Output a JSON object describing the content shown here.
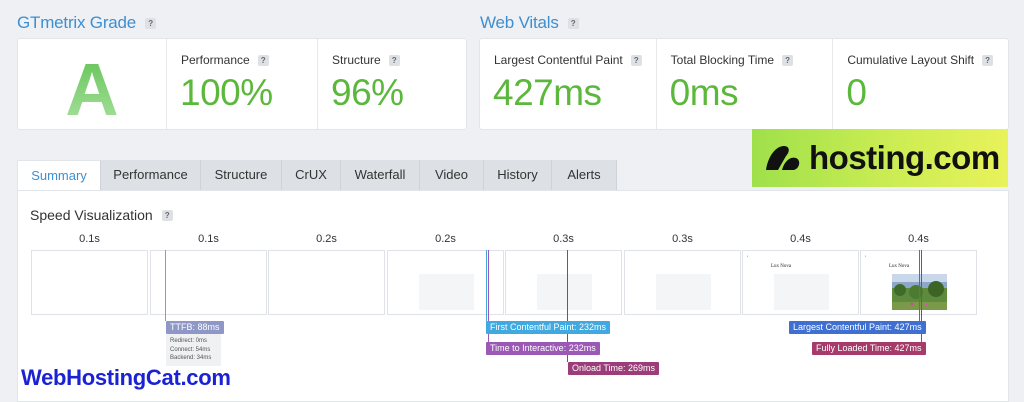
{
  "gtmetrix": {
    "title": "GTmetrix Grade",
    "grade": "A",
    "performance_label": "Performance",
    "performance_value": "100%",
    "structure_label": "Structure",
    "structure_value": "96%"
  },
  "web_vitals": {
    "title": "Web Vitals",
    "lcp_label": "Largest Contentful Paint",
    "lcp_value": "427ms",
    "tbt_label": "Total Blocking Time",
    "tbt_value": "0ms",
    "cls_label": "Cumulative Layout Shift",
    "cls_value": "0"
  },
  "help_icon": "?",
  "ad": {
    "text": "hosting.com",
    "accent": "#b8e84a"
  },
  "tabs": [
    {
      "label": "Summary"
    },
    {
      "label": "Performance"
    },
    {
      "label": "Structure"
    },
    {
      "label": "CrUX"
    },
    {
      "label": "Waterfall"
    },
    {
      "label": "Video"
    },
    {
      "label": "History"
    },
    {
      "label": "Alerts"
    }
  ],
  "speed": {
    "title": "Speed Visualization",
    "timestamps": [
      "0.1s",
      "0.1s",
      "0.2s",
      "0.2s",
      "0.3s",
      "0.3s",
      "0.4s",
      "0.4s"
    ],
    "frame_heading": "Lux Nova",
    "markers": {
      "ttfb": "TTFB: 88ms",
      "redirect": "Redirect: 0ms",
      "connect": "Connect: 54ms",
      "backend": "Backend: 34ms",
      "fcp": "First Contentful Paint: 232ms",
      "tti": "Time to Interactive: 232ms",
      "onload": "Onload Time: 269ms",
      "lcp": "Largest Contentful Paint: 427ms",
      "fully_loaded": "Fully Loaded Time: 427ms"
    }
  },
  "colors": {
    "accent_blue": "#3d8fd1",
    "good_green": "#5cb83c",
    "ttfb": "#8e97c6",
    "fcp": "#3fa9e0",
    "tti": "#9b59b6",
    "onload": "#9b3d78",
    "lcp": "#3f6fd1",
    "fully_loaded": "#a63a6a"
  },
  "watermark": "WebHostingCat.com"
}
